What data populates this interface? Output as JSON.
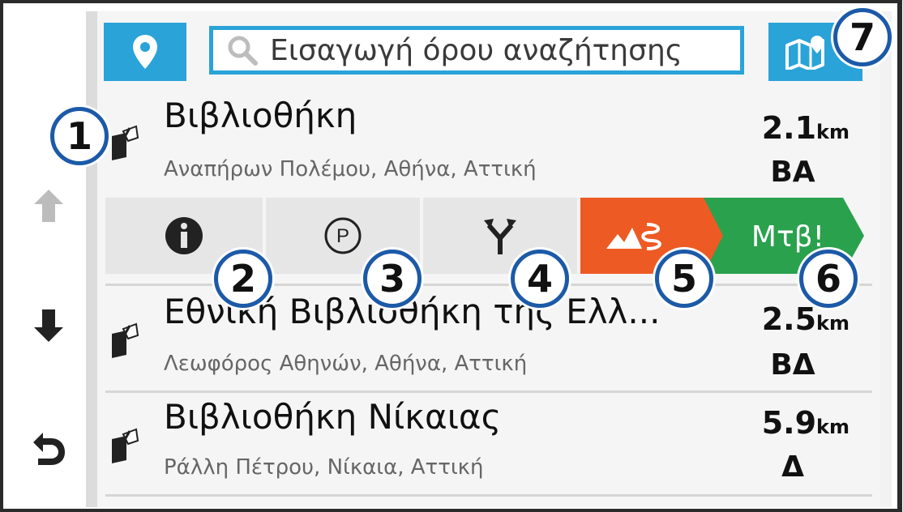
{
  "search": {
    "placeholder": "Εισαγωγή όρου αναζήτησης"
  },
  "results": [
    {
      "name": "Βιβλιοθήκη",
      "address": "Αναπήρων Πολέμου, Αθήνα, Αττική",
      "distance": "2.1",
      "unit": "km",
      "direction": "ΒΑ"
    },
    {
      "name": "Εθνική Βιβλιοθήκη της Ελλ...",
      "address": "Λεωφόρος Αθηνών, Αθήνα, Αττική",
      "distance": "2.5",
      "unit": "km",
      "direction": "ΒΔ"
    },
    {
      "name": "Βιβλιοθήκη Νίκαιας",
      "address": "Ράλλη Πέτρου, Νίκαια, Αττική",
      "distance": "5.9",
      "unit": "km",
      "direction": "Δ"
    }
  ],
  "actions": {
    "info_icon": "info-icon",
    "parking_icon": "parking-icon",
    "route_icon": "route-fork-icon",
    "curvy_icon": "curvy-road-icon",
    "go_label": "Μτβ!"
  },
  "callouts": [
    "1",
    "2",
    "3",
    "4",
    "5",
    "6",
    "7"
  ],
  "colors": {
    "accent": "#2aa3d8",
    "curvy": "#ee5a24",
    "go": "#2aa14d",
    "callout_border": "#1c5aa8"
  }
}
